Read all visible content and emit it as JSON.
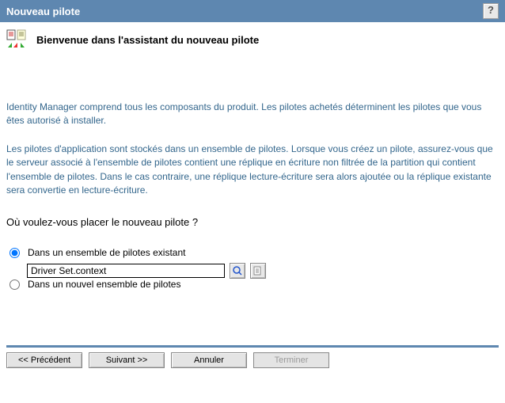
{
  "titlebar": {
    "title": "Nouveau pilote"
  },
  "intro": {
    "heading": "Bienvenue dans l'assistant du nouveau pilote"
  },
  "paragraphs": {
    "p1": "Identity Manager comprend tous les composants du produit. Les pilotes achetés déterminent les pilotes que vous êtes autorisé à installer.",
    "p2": "Les pilotes d'application sont stockés dans un ensemble de pilotes. Lorsque vous créez un pilote, assurez-vous que le serveur associé à l'ensemble de pilotes contient une réplique en écriture non filtrée de la partition qui contient l'ensemble de pilotes. Dans le cas contraire, une réplique lecture-écriture sera alors ajoutée ou la réplique existante sera convertie en lecture-écriture."
  },
  "question": "Où voulez-vous placer le nouveau pilote ?",
  "options": {
    "existing": {
      "label": "Dans un ensemble de pilotes existant",
      "value": "Driver Set.context"
    },
    "new": {
      "label": "Dans un nouvel ensemble de pilotes"
    }
  },
  "buttons": {
    "back": "<< Précédent",
    "next": "Suivant >>",
    "cancel": "Annuler",
    "finish": "Terminer"
  }
}
